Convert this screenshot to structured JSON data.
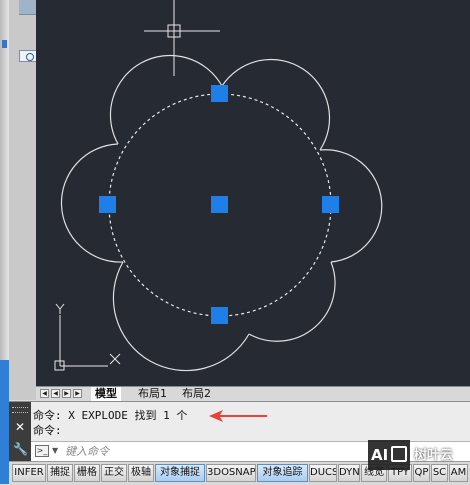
{
  "layout_tabs": [
    {
      "label": "模型",
      "active": true
    },
    {
      "label": "布局1",
      "active": false
    },
    {
      "label": "布局2",
      "active": false
    }
  ],
  "command_window": {
    "history": [
      "命令: X EXPLODE 找到 1 个",
      "命令:"
    ],
    "input_placeholder": "键入命令"
  },
  "status_buttons": [
    {
      "label": "INFER",
      "on": false
    },
    {
      "label": "捕捉",
      "on": false
    },
    {
      "label": "栅格",
      "on": false
    },
    {
      "label": "正交",
      "on": false
    },
    {
      "label": "极轴",
      "on": false
    },
    {
      "label": "对象捕捉",
      "on": true
    },
    {
      "label": "3DOSNAP",
      "on": false
    },
    {
      "label": "对象追踪",
      "on": true
    },
    {
      "label": "DUCS",
      "on": false
    },
    {
      "label": "DYN",
      "on": false
    },
    {
      "label": "线宽",
      "on": false
    },
    {
      "label": "TPY",
      "on": false
    },
    {
      "label": "QP",
      "on": false
    },
    {
      "label": "SC",
      "on": false
    },
    {
      "label": "AM",
      "on": false
    }
  ],
  "ucs_icon": {
    "x_label": "X",
    "y_label": "Y"
  },
  "watermark": {
    "logo": "AI",
    "text": "树叶云"
  },
  "colors": {
    "canvas": "#262a33",
    "grip": "#1e7fe8",
    "annotation_arrow": "#e8403a"
  },
  "icons": {
    "close": "close-icon",
    "wrench": "wrench-icon",
    "prompt": "command-prompt-icon"
  }
}
